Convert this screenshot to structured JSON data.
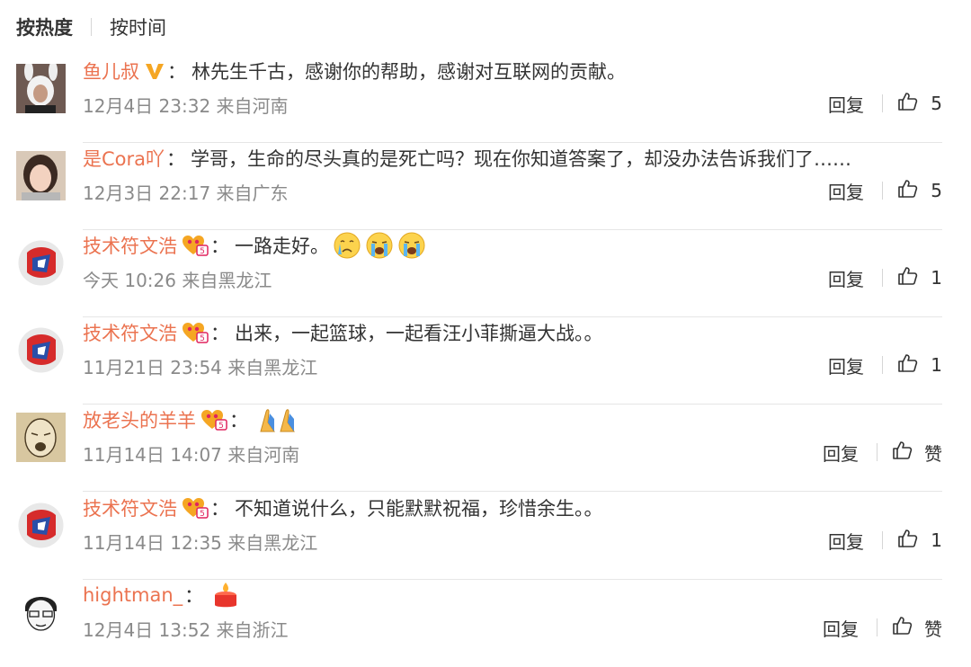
{
  "sort": {
    "hot": "按热度",
    "time": "按时间"
  },
  "comments": [
    {
      "user": "鱼儿叔",
      "badge": "verified-v-icon",
      "text": "林先生千古，感谢你的帮助，感谢对互联网的贡献。",
      "meta": "12月4日 23:32 来自河南",
      "reply": "回复",
      "likes": "5"
    },
    {
      "user": "是Cora吖",
      "badge": "",
      "text": "学哥，生命的尽头真的是死亡吗？现在你知道答案了，却没办法告诉我们了……",
      "meta": "12月3日 22:17 来自广东",
      "reply": "回复",
      "likes": "5"
    },
    {
      "user": "技术符文浩",
      "badge": "fan-heart-icon",
      "text": "一路走好。",
      "emojis": [
        "cry-face-icon",
        "sob-face-icon",
        "sob-face-icon"
      ],
      "meta": "今天 10:26 来自黑龙江",
      "reply": "回复",
      "likes": "1"
    },
    {
      "user": "技术符文浩",
      "badge": "fan-heart-icon",
      "text": "出来，一起篮球，一起看汪小菲撕逼大战。。",
      "meta": "11月21日 23:54 来自黑龙江",
      "reply": "回复",
      "likes": "1"
    },
    {
      "user": "放老头的羊羊",
      "badge": "fan-heart-icon",
      "text": "",
      "emojis": [
        "praying-hands-icon"
      ],
      "meta": "11月14日 14:07 来自河南",
      "reply": "回复",
      "likes": "赞"
    },
    {
      "user": "技术符文浩",
      "badge": "fan-heart-icon",
      "text": "不知道说什么，只能默默祝福，珍惜余生。。",
      "meta": "11月14日 12:35 来自黑龙江",
      "reply": "回复",
      "likes": "1"
    },
    {
      "user": "hightman_",
      "badge": "",
      "text": "",
      "emojis": [
        "candle-icon"
      ],
      "meta": "12月4日 13:52 来自浙江",
      "reply": "回复",
      "likes": "赞"
    }
  ],
  "colors": {
    "username": "#eb7350",
    "meta": "#8a8a8a",
    "divider": "#e6e6e6"
  }
}
